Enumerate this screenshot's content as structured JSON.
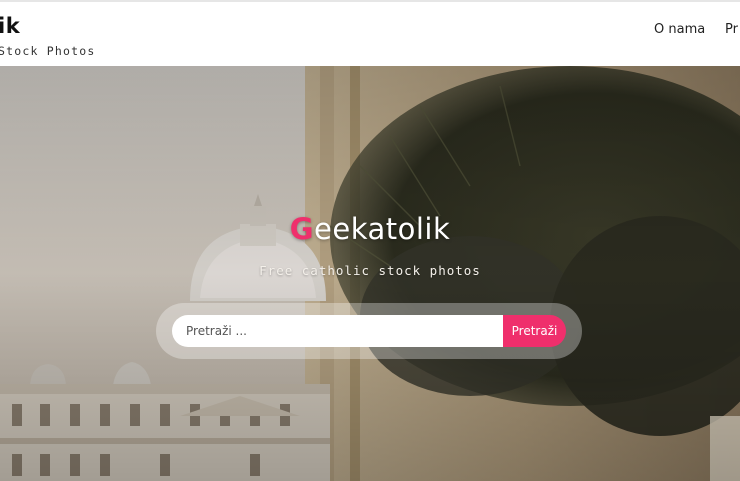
{
  "header": {
    "brand_title": "ik",
    "brand_subtitle": "Stock Photos",
    "nav": [
      {
        "label": "O nama"
      },
      {
        "label": "Pr"
      }
    ]
  },
  "hero": {
    "title_first_letter": "G",
    "title_rest": "eekatolik",
    "subtitle": "Free catholic stock photos",
    "search": {
      "placeholder": "Pretraži ...",
      "value": "",
      "button_label": "Pretraži"
    }
  },
  "colors": {
    "accent": "#ef2f6c",
    "header_bg": "#ffffff",
    "text_dark": "#111111"
  }
}
